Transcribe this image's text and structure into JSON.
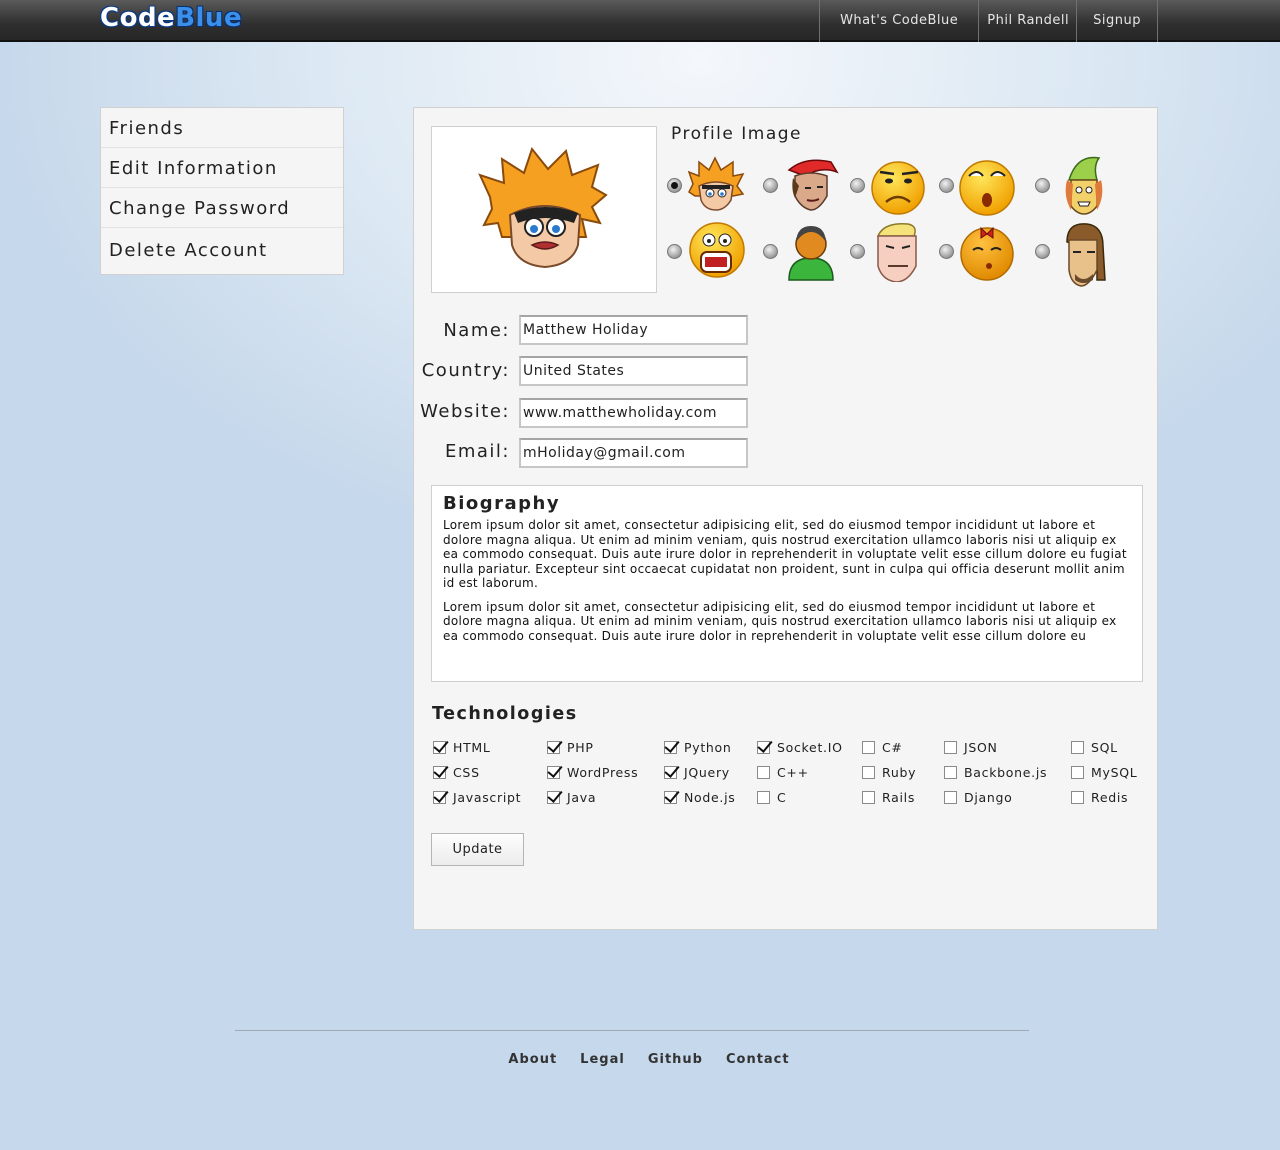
{
  "header": {
    "logo_part1": "Code",
    "logo_part2": "Blue",
    "nav": [
      "What's CodeBlue",
      "Phil Randell",
      "Signup"
    ]
  },
  "sidebar": {
    "items": [
      {
        "label": "Friends"
      },
      {
        "label": "Edit Information"
      },
      {
        "label": "Change Password"
      },
      {
        "label": "Delete Account"
      }
    ]
  },
  "profile": {
    "image_title": "Profile Image",
    "selected_avatar_index": 0,
    "avatars": [
      "spiky-hair-boy-icon",
      "red-cap-boy-icon",
      "frowning-smiley-icon",
      "surprised-smiley-icon",
      "green-hat-elf-icon",
      "screaming-smiley-icon",
      "default-user-icon",
      "blonde-muscle-man-icon",
      "red-bow-smiley-icon",
      "long-hair-man-icon"
    ],
    "fields": {
      "name_label": "Name:",
      "name_value": "Matthew Holiday",
      "country_label": "Country:",
      "country_value": "United States",
      "website_label": "Website:",
      "website_value": "www.matthewholiday.com",
      "email_label": "Email:",
      "email_value": "mHoliday@gmail.com"
    }
  },
  "biography": {
    "title": "Biography",
    "paragraph1": "Lorem ipsum dolor sit amet, consectetur adipisicing elit, sed do eiusmod tempor incididunt ut labore et dolore magna aliqua. Ut enim ad minim veniam, quis nostrud exercitation ullamco laboris nisi ut aliquip ex ea commodo consequat. Duis aute irure dolor in reprehenderit in voluptate velit esse cillum dolore eu fugiat nulla pariatur. Excepteur sint occaecat cupidatat non proident, sunt in culpa qui officia deserunt mollit anim id est laborum.",
    "paragraph2": "Lorem ipsum dolor sit amet, consectetur adipisicing elit, sed do eiusmod tempor incididunt ut labore et dolore magna aliqua. Ut enim ad minim veniam, quis nostrud exercitation ullamco laboris nisi ut aliquip ex ea commodo consequat. Duis aute irure dolor in reprehenderit in voluptate velit esse cillum dolore eu"
  },
  "technologies": {
    "title": "Technologies",
    "items": [
      {
        "label": "HTML",
        "checked": true
      },
      {
        "label": "CSS",
        "checked": true
      },
      {
        "label": "Javascript",
        "checked": true
      },
      {
        "label": "PHP",
        "checked": true
      },
      {
        "label": "WordPress",
        "checked": true
      },
      {
        "label": "Java",
        "checked": true
      },
      {
        "label": "Python",
        "checked": true
      },
      {
        "label": "JQuery",
        "checked": true
      },
      {
        "label": "Node.js",
        "checked": true
      },
      {
        "label": "Socket.IO",
        "checked": true
      },
      {
        "label": "C++",
        "checked": false
      },
      {
        "label": "C",
        "checked": false
      },
      {
        "label": "C#",
        "checked": false
      },
      {
        "label": "Ruby",
        "checked": false
      },
      {
        "label": "Rails",
        "checked": false
      },
      {
        "label": "JSON",
        "checked": false
      },
      {
        "label": "Backbone.js",
        "checked": false
      },
      {
        "label": "Django",
        "checked": false
      },
      {
        "label": "SQL",
        "checked": false
      },
      {
        "label": "MySQL",
        "checked": false
      },
      {
        "label": "Redis",
        "checked": false
      }
    ]
  },
  "update_button": "Update",
  "footer": {
    "links": [
      "About",
      "Legal",
      "Github",
      "Contact"
    ]
  }
}
